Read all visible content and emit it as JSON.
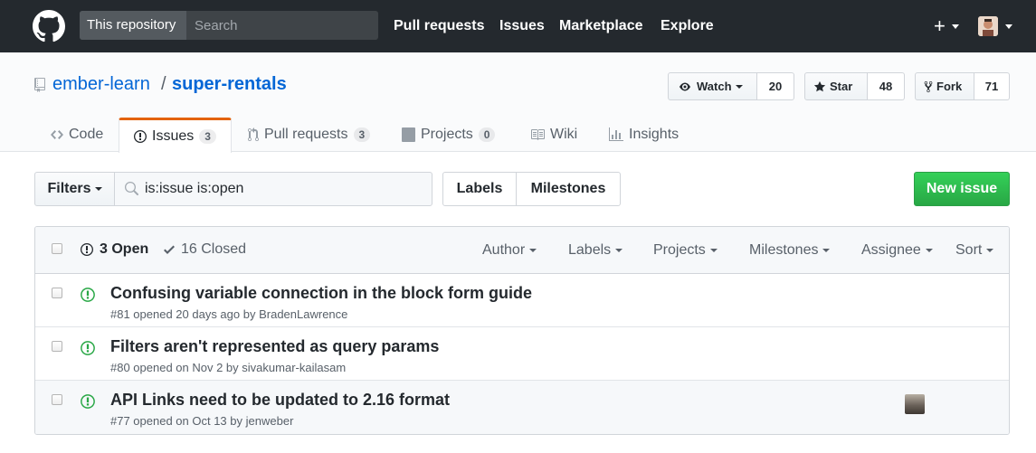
{
  "header": {
    "search_scope": "This repository",
    "search_placeholder": "Search",
    "nav": [
      "Pull requests",
      "Issues",
      "Marketplace",
      "Explore"
    ],
    "plus": "+"
  },
  "repo": {
    "owner": "ember-learn",
    "separator": "/",
    "name": "super-rentals",
    "watch_label": "Watch",
    "watch_count": "20",
    "star_label": "Star",
    "star_count": "48",
    "fork_label": "Fork",
    "fork_count": "71"
  },
  "tabs": [
    {
      "label": "Code",
      "icon": "code-icon"
    },
    {
      "label": "Issues",
      "count": "3",
      "icon": "issue-opened-icon"
    },
    {
      "label": "Pull requests",
      "count": "3",
      "icon": "git-pull-request-icon"
    },
    {
      "label": "Projects",
      "count": "0",
      "icon": "project-icon"
    },
    {
      "label": "Wiki",
      "icon": "book-icon"
    },
    {
      "label": "Insights",
      "icon": "graph-icon"
    }
  ],
  "filterbar": {
    "filters_label": "Filters",
    "query": "is:issue is:open",
    "labels_label": "Labels",
    "milestones_label": "Milestones",
    "new_issue_label": "New issue"
  },
  "list": {
    "open_label": "3 Open",
    "closed_label": "16 Closed",
    "selects": [
      "Author",
      "Labels",
      "Projects",
      "Milestones",
      "Assignee",
      "Sort"
    ]
  },
  "issues": [
    {
      "title": "Confusing variable connection in the block form guide",
      "meta_prefix": "#81 opened 20 days ago by",
      "author": "BradenLawrence"
    },
    {
      "title": "Filters aren't represented as query params",
      "meta_prefix": "#80 opened on Nov 2 by",
      "author": "sivakumar-kailasam"
    },
    {
      "title": "API Links need to be updated to 2.16 format",
      "meta_prefix": "#77 opened on Oct 13 by",
      "author": "jenweber"
    }
  ],
  "colors": {
    "header_bg": "#24292e",
    "link": "#0366d6",
    "open_green": "#28a745",
    "tab_accent": "#e36209"
  }
}
